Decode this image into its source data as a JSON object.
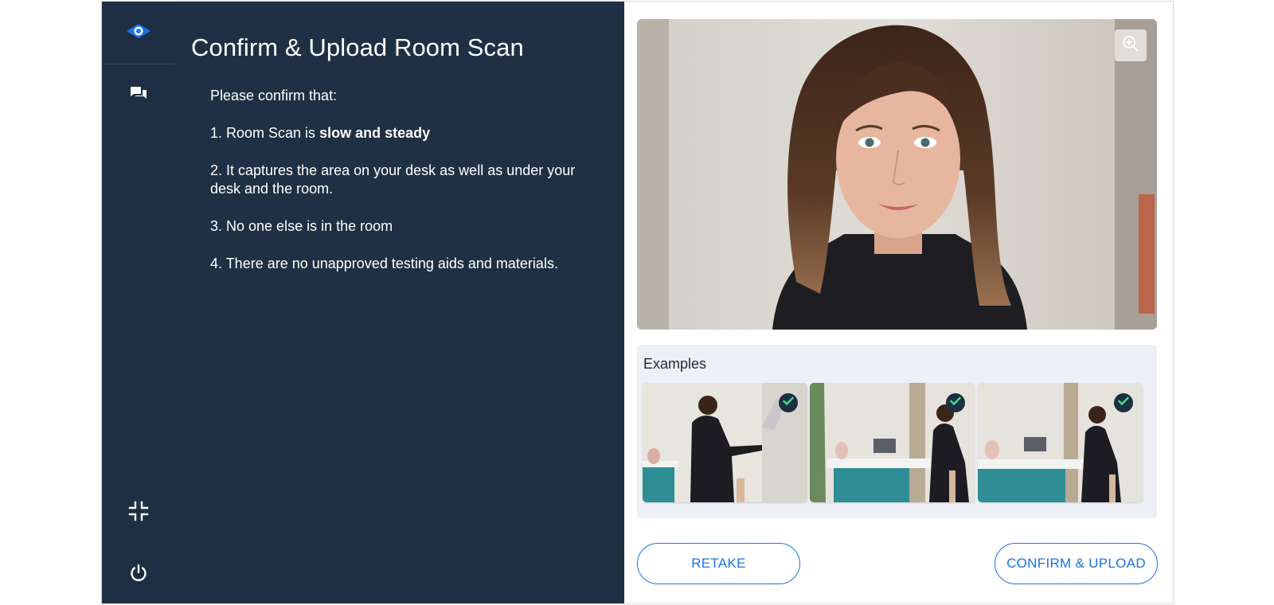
{
  "page": {
    "title": "Confirm & Upload Room Scan"
  },
  "sidebar": {
    "icons": [
      "eye-logo-icon",
      "chat-icon",
      "exit-fullscreen-icon",
      "power-icon"
    ],
    "accent": "#1a73e8"
  },
  "instructions": {
    "intro": "Please confirm that:",
    "item1_prefix": "1. Room Scan is ",
    "item1_bold": "slow and steady",
    "item2": "2. It captures the area on your desk as well as under your desk and the room.",
    "item3": "3. No one else is in the room",
    "item4": "4. There are no unapproved testing aids and materials."
  },
  "examples": {
    "title": "Examples",
    "thumbnails": [
      {
        "status": "approved",
        "icon": "check-circle-icon"
      },
      {
        "status": "approved",
        "icon": "check-circle-icon"
      },
      {
        "status": "approved",
        "icon": "check-circle-icon"
      }
    ]
  },
  "buttons": {
    "retake": "RETAKE",
    "confirm": "CONFIRM & UPLOAD"
  },
  "colors": {
    "panel": "#203044",
    "rail": "#1f2f43",
    "primary": "#1a73e8",
    "check": "#3ddc84"
  }
}
